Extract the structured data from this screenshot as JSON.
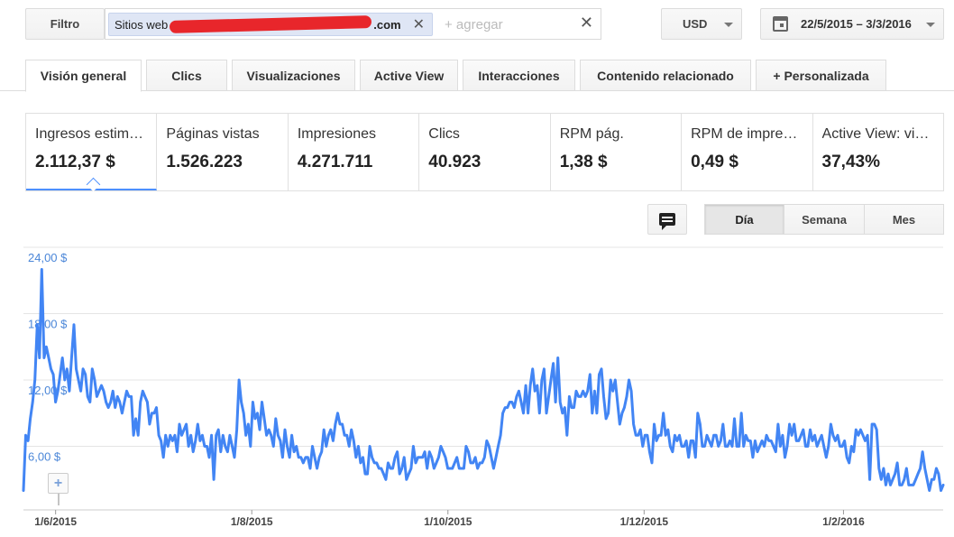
{
  "filter": {
    "button_label": "Filtro",
    "chip_prefix": "Sitios web",
    "chip_suffix": ".com",
    "add_placeholder": "+ agregar",
    "clear_symbol": "✕",
    "chip_remove_symbol": "✕"
  },
  "currency": {
    "label": "USD"
  },
  "date_range": {
    "label": "22/5/2015 – 3/3/2016",
    "icon": "calendar-icon"
  },
  "tabs": [
    {
      "label": "Visión general",
      "active": true
    },
    {
      "label": "Clics"
    },
    {
      "label": "Visualizaciones"
    },
    {
      "label": "Active View"
    },
    {
      "label": "Interacciones"
    },
    {
      "label": "Contenido relacionado"
    },
    {
      "label": "+ Personalizada"
    }
  ],
  "metrics": [
    {
      "label": "Ingresos estim…",
      "value": "2.112,37 $",
      "active": true
    },
    {
      "label": "Páginas vistas",
      "value": "1.526.223"
    },
    {
      "label": "Impresiones",
      "value": "4.271.711"
    },
    {
      "label": "Clics",
      "value": "40.923"
    },
    {
      "label": "RPM pág.",
      "value": "1,38 $"
    },
    {
      "label": "RPM de impre…",
      "value": "0,49 $"
    },
    {
      "label": "Active View: vi…",
      "value": "37,43%"
    }
  ],
  "granularity": [
    {
      "label": "Día",
      "active": true
    },
    {
      "label": "Semana"
    },
    {
      "label": "Mes"
    }
  ],
  "annotation_icon": "comment-icon",
  "add_annotation_symbol": "+",
  "colors": {
    "series": "#4285f4",
    "axis_labels": "#4a86d8",
    "active_metric": "#4d90fe"
  },
  "chart_data": {
    "type": "line",
    "title": "",
    "xlabel": "",
    "ylabel": "",
    "x_start": "22/5/2015",
    "x_end": "3/3/2016",
    "ylim": [
      0,
      24
    ],
    "yticks": [
      "6,00 $",
      "12,00 $",
      "18,00 $",
      "24,00 $"
    ],
    "xticks": [
      "1/6/2015",
      "1/8/2015",
      "1/10/2015",
      "1/12/2015",
      "1/2/2016"
    ],
    "grid": true,
    "series": [
      {
        "color": "#4285f4",
        "values": [
          2,
          7,
          6.5,
          8.5,
          10,
          12,
          17,
          14,
          22,
          14,
          15,
          14,
          13,
          12.5,
          10,
          11,
          12.5,
          14,
          12,
          13,
          11,
          14,
          17,
          13,
          12,
          11,
          13,
          12.5,
          10.5,
          10,
          13,
          12,
          10.5,
          11,
          11.5,
          11,
          10,
          9.5,
          10,
          11,
          9.5,
          10.5,
          10,
          9,
          10,
          11,
          10.5,
          10.5,
          7,
          8.5,
          7,
          10,
          11,
          10.5,
          10,
          8,
          9,
          9,
          9.5,
          7,
          6.5,
          5,
          7,
          6,
          7,
          6.5,
          7,
          5.5,
          8,
          7,
          7.5,
          8,
          6,
          7,
          5.5,
          6.5,
          8,
          6.5,
          7,
          6,
          6,
          5,
          7,
          3,
          7,
          7.5,
          5.5,
          7,
          6,
          5.5,
          7,
          6,
          5,
          7.5,
          12,
          10,
          9,
          7,
          8,
          6,
          10,
          8.5,
          9,
          7.5,
          10,
          8.5,
          7,
          7.5,
          7,
          6,
          8.5,
          7,
          6.5,
          5,
          7.5,
          6,
          5,
          7,
          5.5,
          6,
          5,
          5,
          4.5,
          5,
          5,
          4,
          6,
          5,
          4,
          5,
          5.5,
          7.5,
          6,
          7,
          7.5,
          6.5,
          8,
          9,
          8,
          8,
          7,
          7,
          6,
          7.5,
          6.5,
          5,
          6,
          4.5,
          5,
          3.5,
          3.5,
          6,
          5,
          4.5,
          4.5,
          4,
          4,
          3.5,
          3,
          4.5,
          4,
          4,
          5,
          5.5,
          3.5,
          4,
          5,
          3,
          3.5,
          4,
          6,
          4.5,
          5,
          5,
          5,
          5.5,
          4,
          5.5,
          5,
          4,
          4.5,
          5,
          6,
          5.5,
          5,
          4,
          4,
          4,
          4.5,
          5,
          4,
          4,
          4,
          6,
          5.5,
          4.5,
          4.5,
          5,
          4,
          4.5,
          4.5,
          5,
          6.5,
          6,
          5,
          4,
          5,
          6,
          7,
          9,
          9.5,
          9.5,
          10,
          10,
          9.5,
          10.5,
          11,
          10,
          9,
          11.5,
          9,
          11.5,
          13,
          11,
          11.5,
          9,
          12,
          13,
          9,
          10.5,
          12,
          13.5,
          10,
          14,
          10,
          9,
          9.5,
          7,
          10.5,
          9.5,
          9.5,
          11,
          10.5,
          10.5,
          11,
          10.5,
          11,
          12.5,
          9,
          11,
          9,
          12.5,
          13,
          10.5,
          8.5,
          9,
          12,
          11,
          12,
          10,
          8,
          9,
          9.5,
          10.5,
          12,
          11,
          8,
          7,
          7,
          7.5,
          6,
          7,
          7,
          5.5,
          4.5,
          8,
          6.5,
          7,
          7,
          9,
          7,
          7.5,
          6,
          5.5,
          7,
          6.5,
          7,
          6,
          6,
          6.5,
          5,
          6.5,
          6.5,
          5,
          9,
          8,
          6,
          6,
          7,
          6.5,
          6,
          7,
          7,
          6,
          6.5,
          8,
          6,
          6,
          6.5,
          6,
          8.5,
          6,
          6,
          9,
          6,
          7,
          6.5,
          6.5,
          5,
          6.5,
          5.5,
          6,
          6.5,
          6,
          7,
          6.5,
          6.5,
          6,
          5.5,
          8,
          6,
          7,
          5,
          6,
          8,
          7,
          8,
          6.5,
          6.5,
          7,
          7.5,
          6,
          6,
          7.5,
          6.5,
          7,
          6,
          6.5,
          7,
          6,
          5,
          6,
          8,
          7,
          6.5,
          7,
          6,
          6,
          6.5,
          5,
          4.5,
          6,
          5.5,
          7.5,
          7,
          7.5,
          7,
          6.5,
          7,
          3,
          8,
          8,
          7.5,
          4,
          3,
          4,
          2.5,
          3.5,
          2.5,
          3,
          3.5,
          4.5,
          2.5,
          2.5,
          3,
          4,
          2.5,
          2.5,
          2.5,
          3,
          3.5,
          4,
          5.5,
          4,
          3,
          2,
          3,
          3,
          4,
          3.5,
          2,
          2.5
        ]
      }
    ]
  }
}
